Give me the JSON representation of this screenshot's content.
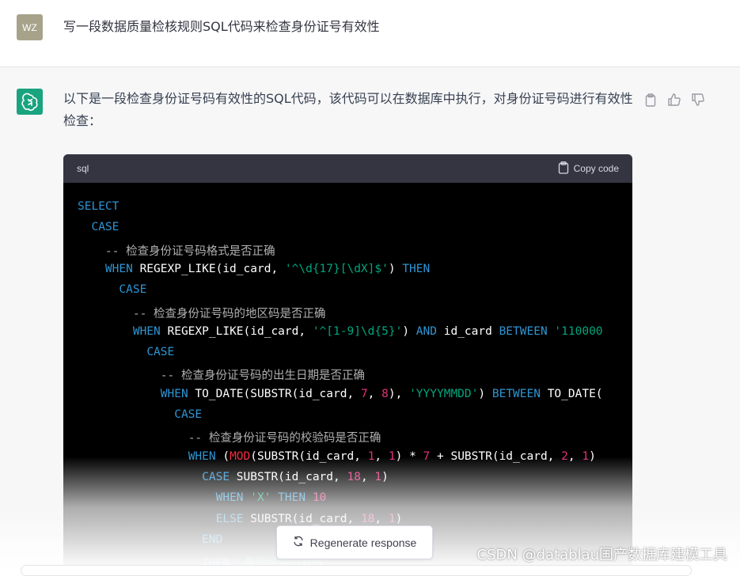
{
  "user": {
    "avatar_initials": "WZ",
    "message": "写一段数据质量检核规则SQL代码来检查身份证号有效性"
  },
  "assistant": {
    "intro": "以下是一段检查身份证号码有效性的SQL代码，该代码可以在数据库中执行，对身份证号码进行有效性检查："
  },
  "actions": {
    "copy_icon": "clipboard-icon",
    "like_icon": "thumbs-up-icon",
    "dislike_icon": "thumbs-down-icon"
  },
  "code": {
    "language": "sql",
    "copy_label": "Copy code",
    "lines": [
      [
        [
          "kw",
          "SELECT"
        ]
      ],
      [
        [
          "",
          "  "
        ],
        [
          "kw",
          "CASE"
        ]
      ],
      [
        [
          "",
          "    "
        ],
        [
          "cm",
          "-- 检查身份证号码格式是否正确"
        ]
      ],
      [
        [
          "",
          "    "
        ],
        [
          "kw",
          "WHEN"
        ],
        [
          "",
          " REGEXP_LIKE(id_card, "
        ],
        [
          "st",
          "'^\\d{17}[\\dX]$'"
        ],
        [
          "",
          ") "
        ],
        [
          "kw",
          "THEN"
        ]
      ],
      [
        [
          "",
          "      "
        ],
        [
          "kw",
          "CASE"
        ]
      ],
      [
        [
          "",
          "        "
        ],
        [
          "cm",
          "-- 检查身份证号码的地区码是否正确"
        ]
      ],
      [
        [
          "",
          "        "
        ],
        [
          "kw",
          "WHEN"
        ],
        [
          "",
          " REGEXP_LIKE(id_card, "
        ],
        [
          "st",
          "'^[1-9]\\d{5}'"
        ],
        [
          "",
          ") "
        ],
        [
          "kw",
          "AND"
        ],
        [
          "",
          " id_card "
        ],
        [
          "kw",
          "BETWEEN"
        ],
        [
          "st",
          " '110000"
        ]
      ],
      [
        [
          "",
          "          "
        ],
        [
          "kw",
          "CASE"
        ]
      ],
      [
        [
          "",
          "            "
        ],
        [
          "cm",
          "-- 检查身份证号码的出生日期是否正确"
        ]
      ],
      [
        [
          "",
          "            "
        ],
        [
          "kw",
          "WHEN"
        ],
        [
          "",
          " TO_DATE(SUBSTR(id_card, "
        ],
        [
          "nm",
          "7"
        ],
        [
          "",
          ", "
        ],
        [
          "nm",
          "8"
        ],
        [
          "",
          "), "
        ],
        [
          "st",
          "'YYYYMMDD'"
        ],
        [
          "",
          ") "
        ],
        [
          "kw",
          "BETWEEN"
        ],
        [
          "",
          " TO_DATE("
        ]
      ],
      [
        [
          "",
          "              "
        ],
        [
          "kw",
          "CASE"
        ]
      ],
      [
        [
          "",
          "                "
        ],
        [
          "cm",
          "-- 检查身份证号码的校验码是否正确"
        ]
      ],
      [
        [
          "",
          "                "
        ],
        [
          "kw",
          "WHEN"
        ],
        [
          "",
          " ("
        ],
        [
          "fn",
          "MOD"
        ],
        [
          "",
          "(SUBSTR(id_card, "
        ],
        [
          "nm",
          "1"
        ],
        [
          "",
          ", "
        ],
        [
          "nm",
          "1"
        ],
        [
          "",
          ") * "
        ],
        [
          "nm",
          "7"
        ],
        [
          "",
          " + SUBSTR(id_card, "
        ],
        [
          "nm",
          "2"
        ],
        [
          "",
          ", "
        ],
        [
          "nm",
          "1"
        ],
        [
          "",
          ")"
        ]
      ],
      [
        [
          "",
          "                  "
        ],
        [
          "kw",
          "CASE"
        ],
        [
          "",
          " SUBSTR(id_card, "
        ],
        [
          "nm",
          "18"
        ],
        [
          "",
          ", "
        ],
        [
          "nm",
          "1"
        ],
        [
          "",
          ")"
        ]
      ],
      [
        [
          "",
          "                    "
        ],
        [
          "kw",
          "WHEN"
        ],
        [
          "st",
          " 'X'"
        ],
        [
          "kw",
          " THEN"
        ],
        [
          "nm",
          " 10"
        ]
      ],
      [
        [
          "",
          "                    "
        ],
        [
          "kw",
          "ELSE"
        ],
        [
          "",
          " SUBSTR(id_card, "
        ],
        [
          "nm",
          "18"
        ],
        [
          "",
          ", "
        ],
        [
          "nm",
          "1"
        ],
        [
          "",
          ")"
        ]
      ],
      [
        [
          "",
          "                  "
        ],
        [
          "kw",
          "END"
        ]
      ],
      [
        [
          "",
          "                  "
        ],
        [
          "kw",
          "THEN"
        ],
        [
          "st",
          " '身份证号码有效'"
        ]
      ]
    ]
  },
  "regenerate": {
    "label": "Regenerate response",
    "icon": "refresh-icon"
  },
  "watermark": "CSDN @datablau国产数据库建模工具"
}
